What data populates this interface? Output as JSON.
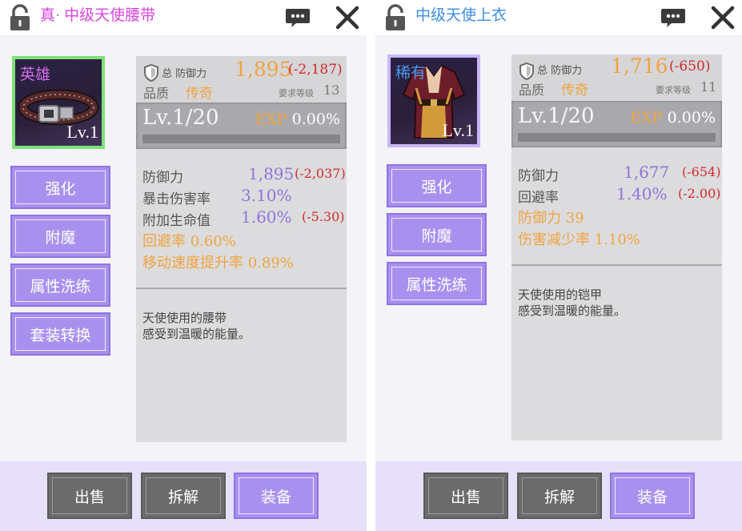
{
  "left": {
    "title": "真· 中级天使腰带",
    "title_color": "#d845e0",
    "rarity": "英雄",
    "rarity_color": "#d46ee6",
    "frame_color": "#7fe07a",
    "item_level": "Lv.1",
    "total_label": "总 防御力",
    "total_value": "1,895",
    "total_diff": "(-2,187)",
    "quality_label": "品质",
    "quality_value": "传奇",
    "req_label": "要求等级",
    "req_value": "13",
    "level_text": "Lv.1/20",
    "exp_label": "EXP",
    "exp_value": "0.00%",
    "exp_fraction": 0,
    "stats": [
      {
        "name": "防御力",
        "value": "1,895",
        "diff": "(-2,037)"
      },
      {
        "name": "暴击伤害率",
        "value": "3.10%",
        "diff": ""
      },
      {
        "name": "附加生命值",
        "value": "1.60%",
        "diff": "(-5.30)"
      }
    ],
    "special_stats": [
      "回避率 0.60%",
      "移动速度提升率 0.89%"
    ],
    "description": [
      "天使使用的腰带",
      "感受到温暖的能量。"
    ],
    "side_buttons": [
      "强化",
      "附魔",
      "属性洗练",
      "套装转换"
    ],
    "bottom_buttons": [
      "出售",
      "拆解",
      "装备"
    ]
  },
  "right": {
    "title": "中级天使上衣",
    "title_color": "#3c8de3",
    "rarity": "稀有",
    "rarity_color": "#4a9af0",
    "frame_color": "#c9b6f7",
    "item_level": "Lv.1",
    "total_label": "总 防御力",
    "total_value": "1,716",
    "total_diff": "(-650)",
    "quality_label": "品质",
    "quality_value": "传奇",
    "req_label": "要求等级",
    "req_value": "11",
    "level_text": "Lv.1/20",
    "exp_label": "EXP",
    "exp_value": "0.00%",
    "exp_fraction": 0,
    "stats": [
      {
        "name": "防御力",
        "value": "1,677",
        "diff": "(-654)"
      },
      {
        "name": "回避率",
        "value": "1.40%",
        "diff": "(-2.00)"
      }
    ],
    "special_stats": [
      "防御力 39",
      "伤害减少率 1.10%"
    ],
    "description": [
      "天使使用的铠甲",
      "感受到温暖的能量。"
    ],
    "side_buttons": [
      "强化",
      "附魔",
      "属性洗练"
    ],
    "bottom_buttons": [
      "出售",
      "拆解",
      "装备"
    ]
  },
  "icons": {
    "lock": "lock-icon",
    "chat": "chat-bubble-icon",
    "close": "close-icon",
    "shield": "shield-icon",
    "belt": "belt-icon",
    "armor": "armor-icon"
  }
}
